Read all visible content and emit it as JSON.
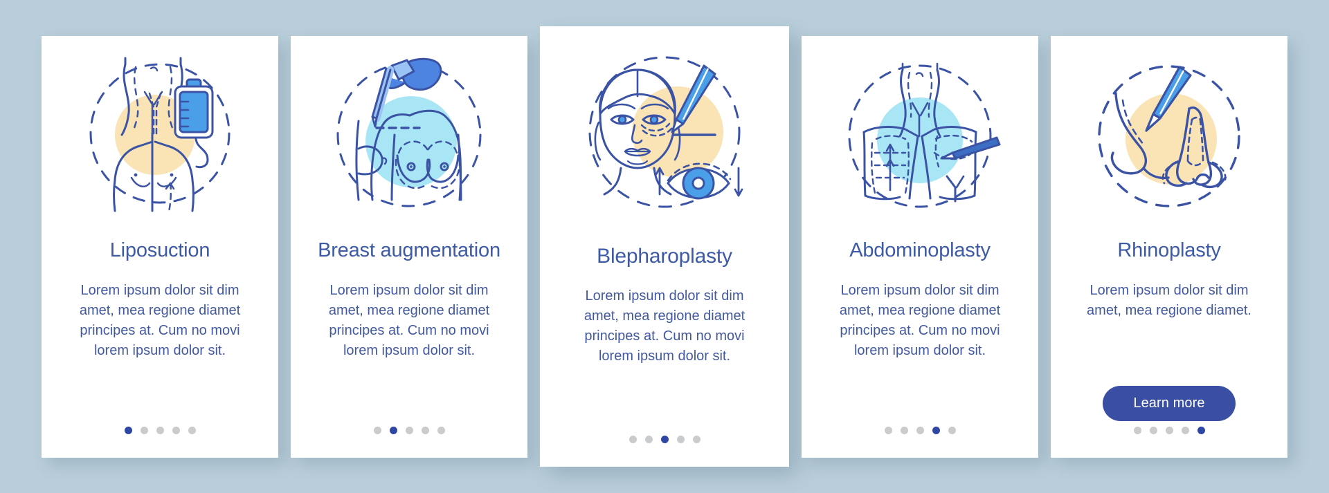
{
  "theme": {
    "page_background": "#b9ceda",
    "card_background": "#ffffff",
    "title_color": "#3c5aa6",
    "body_text_color": "#42599f",
    "button_background": "#3a4fa3",
    "button_text_color": "#ffffff",
    "dot_active_color": "#2e47a5",
    "dot_inactive_color": "#c9cbcd",
    "outline_stroke": "#3b53a4",
    "accent_blue": "#4a9fe8",
    "accent_light_cyan": "#9fe3f4",
    "accent_cream": "#fae3b4"
  },
  "cards": [
    {
      "id": "liposuction",
      "icon": "liposuction-illustration",
      "title": "Liposuction",
      "description": "Lorem ipsum dolor sit dim amet, mea regione diamet principes at. Cum no movi lorem ipsum dolor sit.",
      "has_button": false,
      "button_label": "",
      "dots": {
        "count": 5,
        "active_index": 0
      },
      "featured": false
    },
    {
      "id": "breast-augmentation",
      "icon": "breast-augmentation-illustration",
      "title": "Breast augmentation",
      "description": "Lorem ipsum dolor sit dim amet, mea regione diamet principes at. Cum no movi lorem ipsum dolor sit.",
      "has_button": false,
      "button_label": "",
      "dots": {
        "count": 5,
        "active_index": 1
      },
      "featured": false
    },
    {
      "id": "blepharoplasty",
      "icon": "blepharoplasty-illustration",
      "title": "Blepharoplasty",
      "description": "Lorem ipsum dolor sit dim amet, mea regione diamet principes at. Cum no movi lorem ipsum dolor sit.",
      "has_button": false,
      "button_label": "",
      "dots": {
        "count": 5,
        "active_index": 2
      },
      "featured": true
    },
    {
      "id": "abdominoplasty",
      "icon": "abdominoplasty-illustration",
      "title": "Abdominoplasty",
      "description": "Lorem ipsum dolor sit dim amet, mea regione diamet principes at. Cum no movi lorem ipsum dolor sit.",
      "has_button": false,
      "button_label": "",
      "dots": {
        "count": 5,
        "active_index": 3
      },
      "featured": false
    },
    {
      "id": "rhinoplasty",
      "icon": "rhinoplasty-illustration",
      "title": "Rhinoplasty",
      "description": "Lorem ipsum dolor sit dim amet, mea regione diamet.",
      "has_button": true,
      "button_label": "Learn more",
      "dots": {
        "count": 5,
        "active_index": 4
      },
      "featured": false
    }
  ]
}
